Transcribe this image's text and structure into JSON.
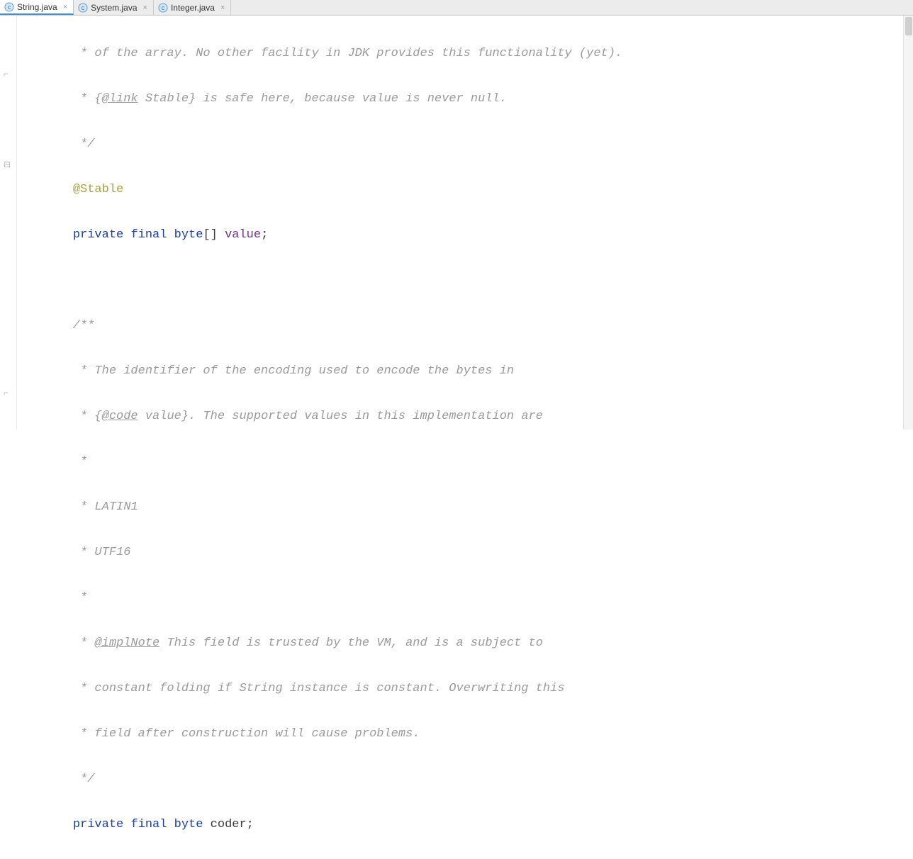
{
  "tabs": [
    {
      "label": "String.java",
      "active": true
    },
    {
      "label": "System.java",
      "active": false
    },
    {
      "label": "Integer.java",
      "active": false
    }
  ],
  "code": {
    "l1": "     * of the array. No other facility in JDK provides this functionality (yet).",
    "l2a": "     * {",
    "l2b": "@link",
    "l2c": " Stable",
    "l2d": "} is safe here, because value is never null.",
    "l3": "     */",
    "l4": "@Stable",
    "l5a": "private",
    "l5b": "final",
    "l5c": "byte",
    "l5d": "[] ",
    "l5e": "value",
    "l5f": ";",
    "l6": "",
    "l7": "    /**",
    "l8": "     * The identifier of the encoding used to encode the bytes in",
    "l9a": "     * {",
    "l9b": "@code",
    "l9c": " value}. The supported values in this implementation are",
    "l10": "     *",
    "l11": "     * LATIN1",
    "l12": "     * UTF16",
    "l13": "     *",
    "l14a": "     * ",
    "l14b": "@implNote",
    "l14c": " This field is trusted by the VM, and is a subject to",
    "l15": "     * constant folding if String instance is constant. Overwriting this",
    "l16": "     * field after construction will cause problems.",
    "l17": "     */",
    "l18a": "private",
    "l18b": "final",
    "l18c": "byte",
    "l18d": " coder;"
  }
}
